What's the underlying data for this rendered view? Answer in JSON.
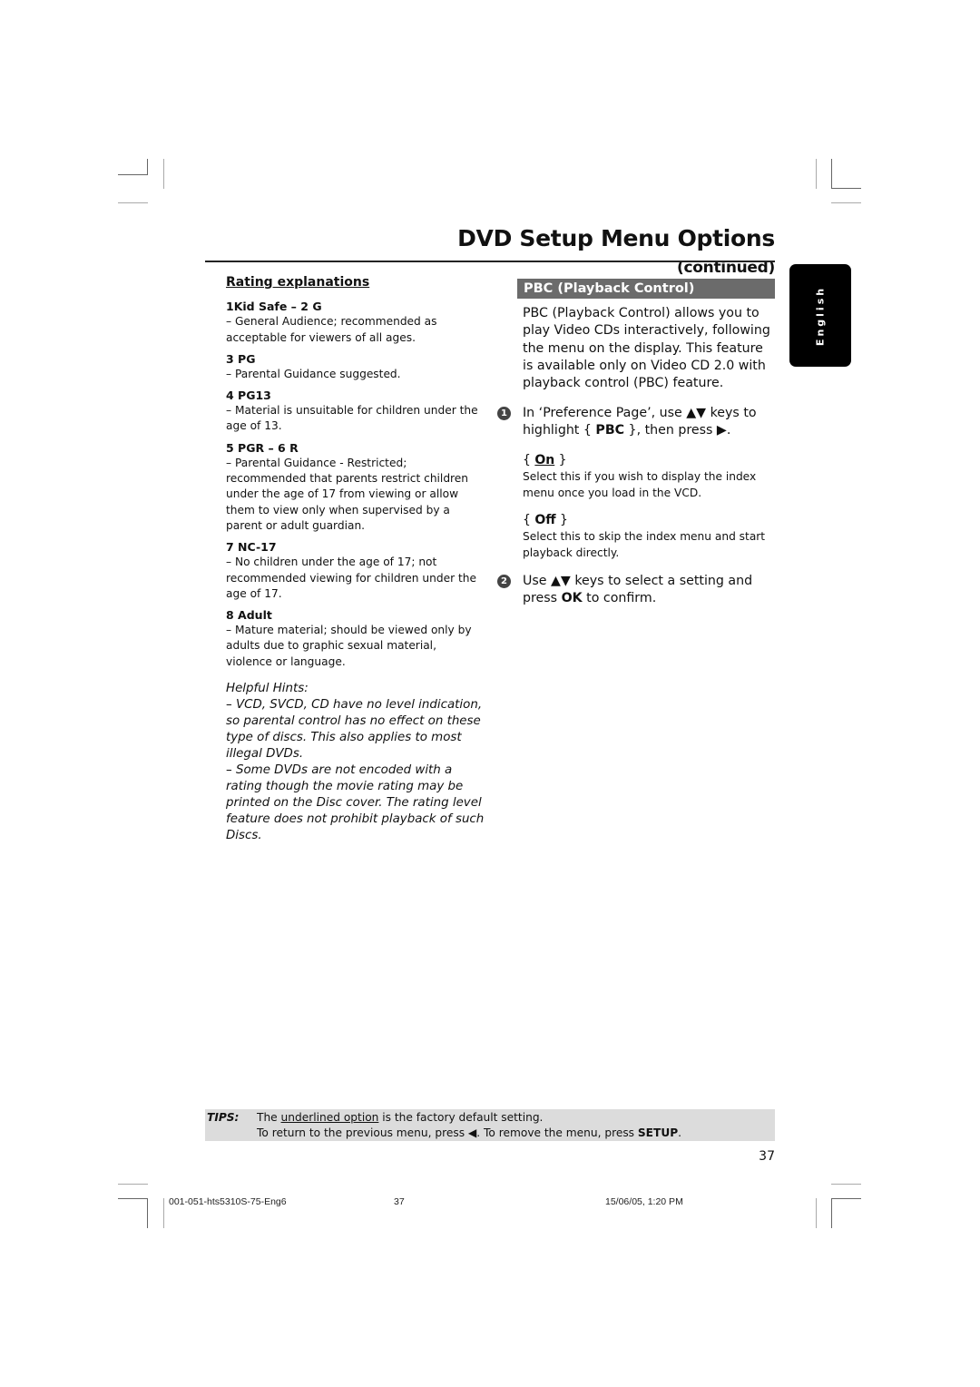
{
  "header": {
    "title": "DVD Setup Menu Options",
    "title_suffix": "(continued)"
  },
  "language_tab": "English",
  "left_column": {
    "section_title": "Rating explanations",
    "ratings": [
      {
        "heading": "1Kid Safe – 2 G",
        "desc": "–   General Audience; recommended as acceptable for viewers of all ages."
      },
      {
        "heading": "3 PG",
        "desc": "–   Parental Guidance suggested."
      },
      {
        "heading": "4 PG13",
        "desc": "–   Material is unsuitable for children under the age of 13."
      },
      {
        "heading": "5 PGR – 6 R",
        "desc": "–   Parental Guidance - Restricted; recommended that parents restrict children under the age of 17 from viewing or allow them to view only when supervised by a parent or adult guardian."
      },
      {
        "heading": "7 NC-17",
        "desc": "–   No children under the age of 17; not recommended viewing for children under the age of 17."
      },
      {
        "heading": "8  Adult",
        "desc": "–   Mature material; should be viewed only by adults due to graphic sexual material, violence or language."
      }
    ],
    "hints_title": "Helpful Hints:",
    "hints": [
      "–  VCD, SVCD, CD have no level indication, so parental control has no effect on these type of discs. This also applies to most illegal DVDs.",
      "–  Some DVDs are not encoded with a rating though the movie rating may be printed on the Disc cover. The rating level feature does not prohibit playback of such Discs."
    ]
  },
  "right_column": {
    "section_title": "PBC (Playback Control)",
    "intro": "PBC (Playback Control) allows you to play Video CDs interactively, following the menu on the display. This feature is available only on Video CD 2.0 with playback control (PBC) feature.",
    "step1": {
      "num": "1",
      "pre": "In ‘Preference Page’, use ▲▼ keys to highlight { ",
      "bold": "PBC",
      "post": " }, then press ▶."
    },
    "options": [
      {
        "open": "{ ",
        "label": "On",
        "close": " }",
        "default": true,
        "desc": "Select this if you wish to display the index menu once you load in the VCD."
      },
      {
        "open": "{ ",
        "label": "Off",
        "close": " }",
        "default": false,
        "desc": "Select this to skip the index menu and start playback directly."
      }
    ],
    "step2": {
      "num": "2",
      "pre": "Use ▲▼ keys to select a setting and press ",
      "bold": "OK",
      "post": " to confirm."
    }
  },
  "tips": {
    "label": "TIPS:",
    "line1_pre": "The ",
    "line1_underlined": "underlined option",
    "line1_post": " is the factory default setting.",
    "line2_pre": "To return to the previous menu, press ◀.  To remove the menu, press ",
    "line2_bold": "SETUP",
    "line2_post": "."
  },
  "page_number": "37",
  "footer": {
    "file": "001-051-hts5310S-75-Eng6",
    "page": "37",
    "timestamp": "15/06/05, 1:20 PM"
  }
}
